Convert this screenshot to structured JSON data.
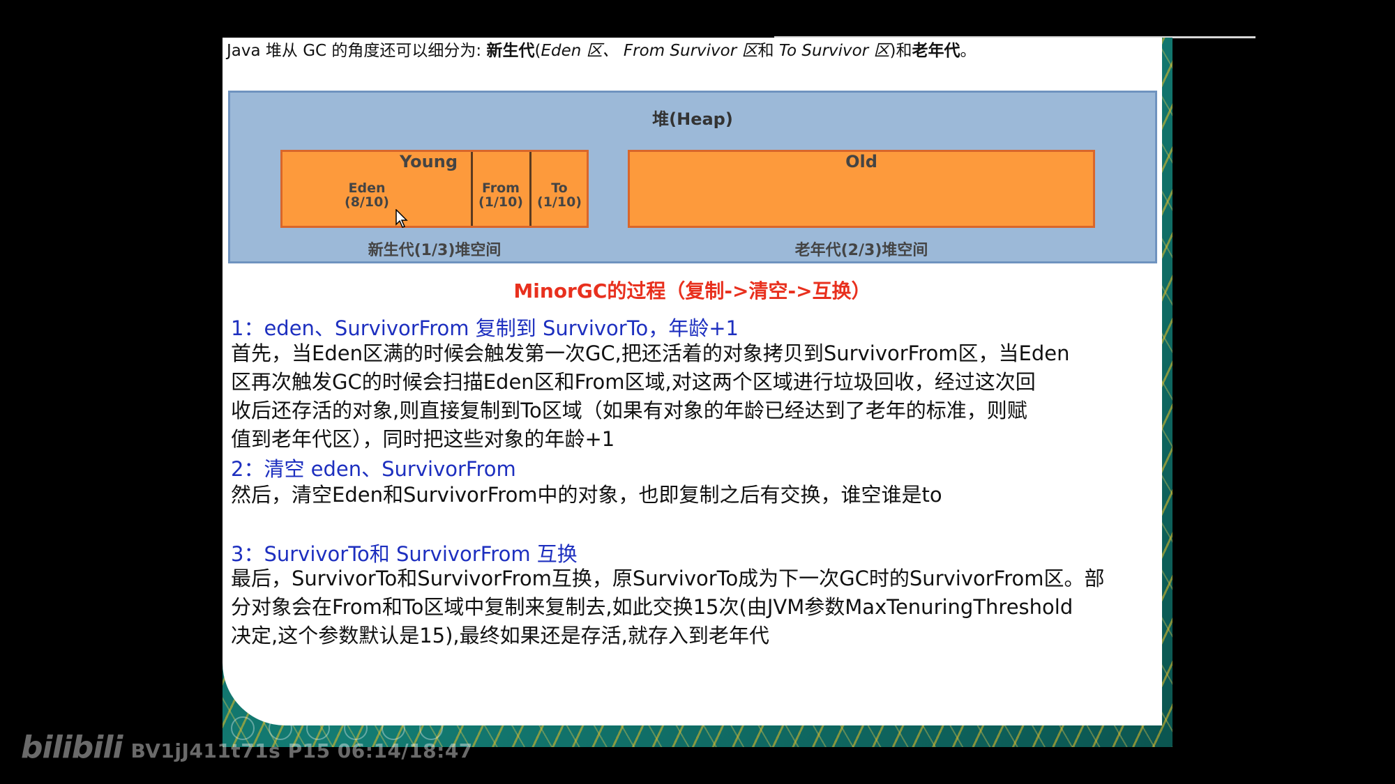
{
  "intro": {
    "p1": "Java 堆从 GC 的角度还可以细分为: ",
    "b1": "新生代",
    "p2": "(",
    "i1": "Eden 区、 From Survivor 区",
    "p3": "和 ",
    "i2": "To Survivor 区",
    "p4": ")和",
    "b2": "老年代",
    "p5": "。"
  },
  "heap": {
    "title": "堆(Heap)",
    "young_title": "Young",
    "eden": "Eden",
    "eden_ratio": "(8/10)",
    "from": "From",
    "from_ratio": "(1/10)",
    "to": "To",
    "to_ratio": "(1/10)",
    "old_title": "Old",
    "young_caption": "新生代(1/3)堆空间",
    "old_caption": "老年代(2/3)堆空间"
  },
  "section_title": "MinorGC的过程（复制->清空->互换）",
  "steps": [
    {
      "title": "1：eden、SurvivorFrom 复制到 SurvivorTo，年龄+1",
      "lines": [
        "首先，当Eden区满的时候会触发第一次GC,把还活着的对象拷贝到SurvivorFrom区，当Eden",
        "区再次触发GC的时候会扫描Eden区和From区域,对这两个区域进行垃圾回收，经过这次回",
        "收后还存活的对象,则直接复制到To区域（如果有对象的年龄已经达到了老年的标准，则赋",
        "值到老年代区），同时把这些对象的年龄+1"
      ]
    },
    {
      "title": "2：清空 eden、SurvivorFrom",
      "lines": [
        "然后，清空Eden和SurvivorFrom中的对象，也即复制之后有交换，谁空谁是to"
      ]
    },
    {
      "title": "3：SurvivorTo和 SurvivorFrom 互换",
      "lines": [
        "最后，SurvivorTo和SurvivorFrom互换，原SurvivorTo成为下一次GC时的SurvivorFrom区。部",
        "分对象会在From和To区域中复制来复制去,如此交换15次(由JVM参数MaxTenuringThreshold",
        "决定,这个参数默认是15),最终如果还是存活,就存入到老年代"
      ]
    }
  ],
  "watermark": {
    "logo": "bilibili",
    "text": "BV1jJ411t71s P15 06:14/18:47"
  },
  "colors": {
    "step_title": "#1d2fbf",
    "section_title": "#e8301e",
    "heap_bg": "#9cb9d8",
    "region_fill": "#fd9a3c"
  }
}
